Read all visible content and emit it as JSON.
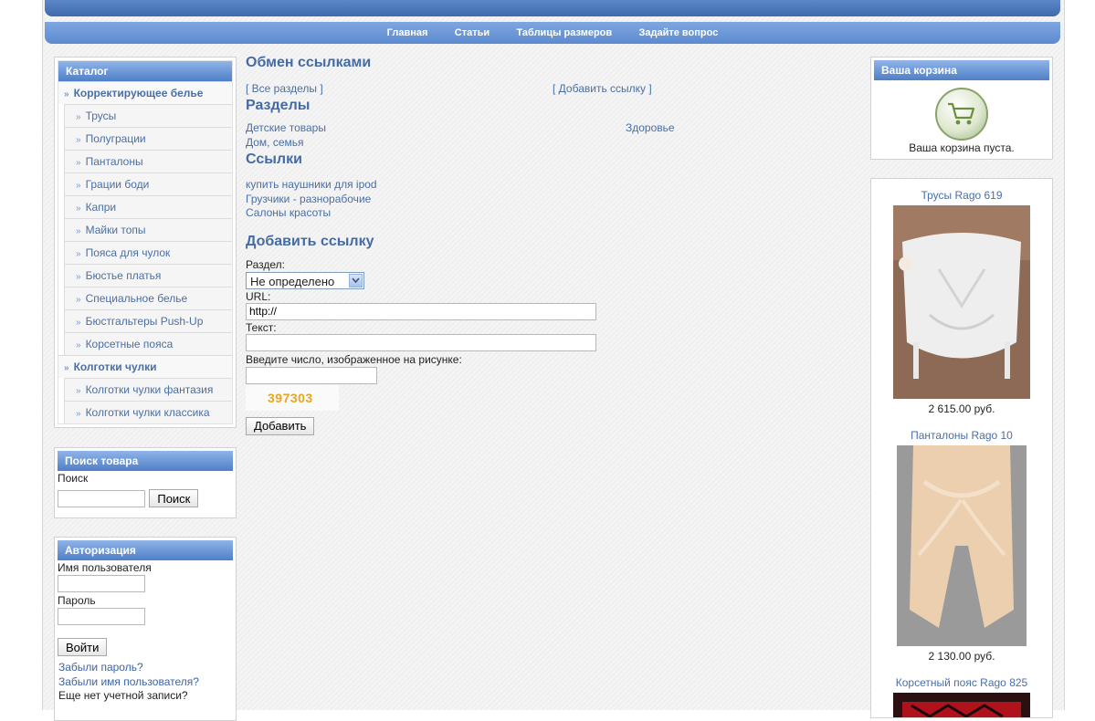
{
  "nav": [
    "Главная",
    "Статьи",
    "Таблицы размеров",
    "Задайте вопрос"
  ],
  "catalog": {
    "title": "Каталог",
    "items": [
      {
        "label": "Корректирующее белье",
        "type": "parent"
      },
      {
        "label": "Трусы",
        "type": "child"
      },
      {
        "label": "Полуграции",
        "type": "child"
      },
      {
        "label": "Панталоны",
        "type": "child"
      },
      {
        "label": "Грации боди",
        "type": "child"
      },
      {
        "label": "Капри",
        "type": "child"
      },
      {
        "label": "Майки топы",
        "type": "child"
      },
      {
        "label": "Пояса для чулок",
        "type": "child"
      },
      {
        "label": "Бюстье платья",
        "type": "child"
      },
      {
        "label": "Специальное белье",
        "type": "child"
      },
      {
        "label": "Бюстгальтеры Push-Up",
        "type": "child"
      },
      {
        "label": "Корсетные пояса",
        "type": "child"
      },
      {
        "label": "Колготки чулки",
        "type": "parent"
      },
      {
        "label": "Колготки чулки фантазия",
        "type": "child"
      },
      {
        "label": "Колготки чулки классика",
        "type": "child"
      }
    ]
  },
  "search": {
    "title": "Поиск товара",
    "label": "Поиск",
    "value": "",
    "button": "Поиск"
  },
  "auth": {
    "title": "Авторизация",
    "username_label": "Имя пользователя",
    "password_label": "Пароль",
    "login_button": "Войти",
    "forgot_password": "Забыли пароль?",
    "forgot_username": "Забыли имя пользователя?",
    "no_account": "Еще нет учетной записи?"
  },
  "main": {
    "title": "Обмен ссылками",
    "all_sections": "[ Все разделы ]",
    "add_link_top": "[ Добавить ссылку ]",
    "sections_heading": "Разделы",
    "sections_left": [
      "Детские товары",
      "Дом, семья"
    ],
    "sections_right": [
      "Здоровье"
    ],
    "links_heading": "Ссылки",
    "links": [
      "купить наушники для ipod",
      "Грузчики - разнорабочие",
      "Салоны красоты"
    ],
    "form": {
      "heading": "Добавить ссылку",
      "section_label": "Раздел:",
      "section_value": "Не определено",
      "url_label": "URL:",
      "url_value": "http://",
      "text_label": "Текст:",
      "text_value": "",
      "captcha_label": "Введите число, изображенное на рисунке:",
      "captcha_value": "",
      "captcha_code": "397303",
      "submit": "Добавить"
    }
  },
  "cart": {
    "title": "Ваша корзина",
    "empty_text": "Ваша корзина пуста."
  },
  "products": [
    {
      "title": "Трусы Rago 619",
      "price": "2 615.00 руб."
    },
    {
      "title": "Панталоны Rago 10",
      "price": "2 130.00 руб."
    },
    {
      "title": "Корсетный пояс Rago 825",
      "price": ""
    }
  ],
  "colors": {
    "accent": "#4f7fc7",
    "link": "#4a6fa5",
    "heading": "#456ba5"
  }
}
